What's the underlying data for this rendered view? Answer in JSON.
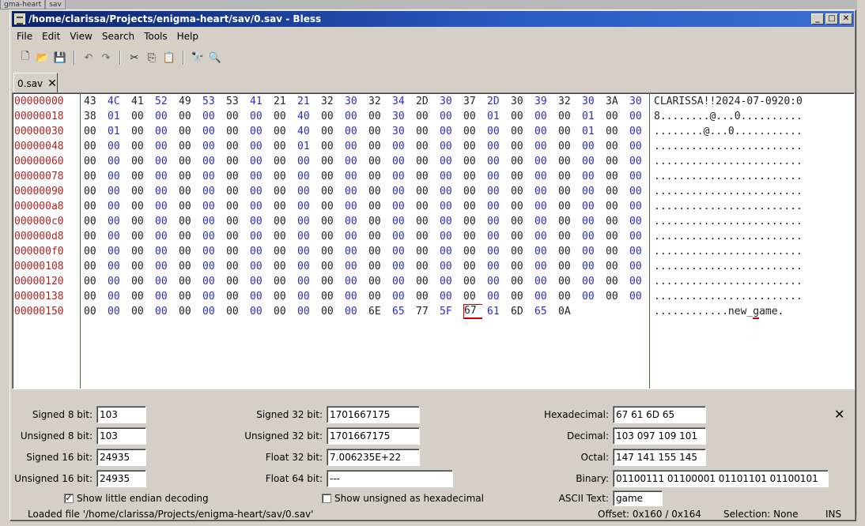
{
  "desktop": {
    "tabs": [
      "gma-heart",
      "sav"
    ]
  },
  "window": {
    "title": "/home/clarissa/Projects/enigma-heart/sav/0.sav - Bless"
  },
  "menu": [
    "File",
    "Edit",
    "View",
    "Search",
    "Tools",
    "Help"
  ],
  "toolbar": [
    {
      "name": "new-file-icon",
      "glyph": "🗋"
    },
    {
      "name": "open-folder-icon",
      "glyph": "📂"
    },
    {
      "name": "save-icon",
      "glyph": "💾"
    },
    {
      "name": "undo-icon",
      "glyph": "↶"
    },
    {
      "name": "redo-icon",
      "glyph": "↷"
    },
    {
      "name": "cut-icon",
      "glyph": "✂"
    },
    {
      "name": "copy-icon",
      "glyph": "⎘"
    },
    {
      "name": "paste-icon",
      "glyph": "📋"
    },
    {
      "name": "find-icon",
      "glyph": "🔭"
    },
    {
      "name": "replace-icon",
      "glyph": "🔍"
    }
  ],
  "tab": {
    "label": "0.sav"
  },
  "hex": {
    "rows": [
      {
        "offset": "00000000",
        "bytes": [
          "43",
          "4C",
          "41",
          "52",
          "49",
          "53",
          "53",
          "41",
          "21",
          "21",
          "32",
          "30",
          "32",
          "34",
          "2D",
          "30",
          "37",
          "2D",
          "30",
          "39",
          "32",
          "30",
          "3A",
          "30"
        ],
        "ascii": "CLARISSA!!2024-07-0920:0"
      },
      {
        "offset": "00000018",
        "bytes": [
          "38",
          "01",
          "00",
          "00",
          "00",
          "00",
          "00",
          "00",
          "00",
          "40",
          "00",
          "00",
          "00",
          "30",
          "00",
          "00",
          "00",
          "01",
          "00",
          "00",
          "00",
          "01",
          "00",
          "00"
        ],
        "ascii": "8........@...0.........."
      },
      {
        "offset": "00000030",
        "bytes": [
          "00",
          "01",
          "00",
          "00",
          "00",
          "00",
          "00",
          "00",
          "00",
          "40",
          "00",
          "00",
          "00",
          "30",
          "00",
          "00",
          "00",
          "00",
          "00",
          "00",
          "00",
          "01",
          "00",
          "00"
        ],
        "ascii": "........@...0..........."
      },
      {
        "offset": "00000048",
        "bytes": [
          "00",
          "00",
          "00",
          "00",
          "00",
          "00",
          "00",
          "00",
          "00",
          "01",
          "00",
          "00",
          "00",
          "00",
          "00",
          "00",
          "00",
          "00",
          "00",
          "00",
          "00",
          "00",
          "00",
          "00"
        ],
        "ascii": "........................"
      },
      {
        "offset": "00000060",
        "bytes": [
          "00",
          "00",
          "00",
          "00",
          "00",
          "00",
          "00",
          "00",
          "00",
          "00",
          "00",
          "00",
          "00",
          "00",
          "00",
          "00",
          "00",
          "00",
          "00",
          "00",
          "00",
          "00",
          "00",
          "00"
        ],
        "ascii": "........................"
      },
      {
        "offset": "00000078",
        "bytes": [
          "00",
          "00",
          "00",
          "00",
          "00",
          "00",
          "00",
          "00",
          "00",
          "00",
          "00",
          "00",
          "00",
          "00",
          "00",
          "00",
          "00",
          "00",
          "00",
          "00",
          "00",
          "00",
          "00",
          "00"
        ],
        "ascii": "........................"
      },
      {
        "offset": "00000090",
        "bytes": [
          "00",
          "00",
          "00",
          "00",
          "00",
          "00",
          "00",
          "00",
          "00",
          "00",
          "00",
          "00",
          "00",
          "00",
          "00",
          "00",
          "00",
          "00",
          "00",
          "00",
          "00",
          "00",
          "00",
          "00"
        ],
        "ascii": "........................"
      },
      {
        "offset": "000000a8",
        "bytes": [
          "00",
          "00",
          "00",
          "00",
          "00",
          "00",
          "00",
          "00",
          "00",
          "00",
          "00",
          "00",
          "00",
          "00",
          "00",
          "00",
          "00",
          "00",
          "00",
          "00",
          "00",
          "00",
          "00",
          "00"
        ],
        "ascii": "........................"
      },
      {
        "offset": "000000c0",
        "bytes": [
          "00",
          "00",
          "00",
          "00",
          "00",
          "00",
          "00",
          "00",
          "00",
          "00",
          "00",
          "00",
          "00",
          "00",
          "00",
          "00",
          "00",
          "00",
          "00",
          "00",
          "00",
          "00",
          "00",
          "00"
        ],
        "ascii": "........................"
      },
      {
        "offset": "000000d8",
        "bytes": [
          "00",
          "00",
          "00",
          "00",
          "00",
          "00",
          "00",
          "00",
          "00",
          "00",
          "00",
          "00",
          "00",
          "00",
          "00",
          "00",
          "00",
          "00",
          "00",
          "00",
          "00",
          "00",
          "00",
          "00"
        ],
        "ascii": "........................"
      },
      {
        "offset": "000000f0",
        "bytes": [
          "00",
          "00",
          "00",
          "00",
          "00",
          "00",
          "00",
          "00",
          "00",
          "00",
          "00",
          "00",
          "00",
          "00",
          "00",
          "00",
          "00",
          "00",
          "00",
          "00",
          "00",
          "00",
          "00",
          "00"
        ],
        "ascii": "........................"
      },
      {
        "offset": "00000108",
        "bytes": [
          "00",
          "00",
          "00",
          "00",
          "00",
          "00",
          "00",
          "00",
          "00",
          "00",
          "00",
          "00",
          "00",
          "00",
          "00",
          "00",
          "00",
          "00",
          "00",
          "00",
          "00",
          "00",
          "00",
          "00"
        ],
        "ascii": "........................"
      },
      {
        "offset": "00000120",
        "bytes": [
          "00",
          "00",
          "00",
          "00",
          "00",
          "00",
          "00",
          "00",
          "00",
          "00",
          "00",
          "00",
          "00",
          "00",
          "00",
          "00",
          "00",
          "00",
          "00",
          "00",
          "00",
          "00",
          "00",
          "00"
        ],
        "ascii": "........................"
      },
      {
        "offset": "00000138",
        "bytes": [
          "00",
          "00",
          "00",
          "00",
          "00",
          "00",
          "00",
          "00",
          "00",
          "00",
          "00",
          "00",
          "00",
          "00",
          "00",
          "00",
          "00",
          "00",
          "00",
          "00",
          "00",
          "00",
          "00",
          "00"
        ],
        "ascii": "........................"
      },
      {
        "offset": "00000150",
        "bytes": [
          "00",
          "00",
          "00",
          "00",
          "00",
          "00",
          "00",
          "00",
          "00",
          "00",
          "00",
          "00",
          "6E",
          "65",
          "77",
          "5F",
          "67",
          "61",
          "6D",
          "65",
          "0A"
        ],
        "ascii": "............new_game."
      }
    ],
    "cursor": {
      "row": 14,
      "byte": 16
    }
  },
  "inspector": {
    "signed8_label": "Signed 8 bit:",
    "signed8": "103",
    "unsigned8_label": "Unsigned 8 bit:",
    "unsigned8": "103",
    "signed16_label": "Signed 16 bit:",
    "signed16": "24935",
    "unsigned16_label": "Unsigned 16 bit:",
    "unsigned16": "24935",
    "signed32_label": "Signed 32 bit:",
    "signed32": "1701667175",
    "unsigned32_label": "Unsigned 32 bit:",
    "unsigned32": "1701667175",
    "float32_label": "Float 32 bit:",
    "float32": "7.006235E+22",
    "float64_label": "Float 64 bit:",
    "float64": "---",
    "hex_label": "Hexadecimal:",
    "hex": "67 61 6D 65",
    "dec_label": "Decimal:",
    "dec": "103 097 109 101",
    "oct_label": "Octal:",
    "oct": "147 141 155 145",
    "bin_label": "Binary:",
    "bin": "01100111 01100001 01101101 01100101",
    "ascii_label": "ASCII Text:",
    "ascii": "game",
    "little_endian_label": "Show little endian decoding",
    "little_endian_checked": true,
    "unsigned_hex_label": "Show unsigned as hexadecimal",
    "unsigned_hex_checked": false
  },
  "status": {
    "loaded": "Loaded file '/home/clarissa/Projects/enigma-heart/sav/0.sav'",
    "offset": "Offset: 0x160 / 0x164",
    "selection": "Selection: None",
    "mode": "INS"
  }
}
